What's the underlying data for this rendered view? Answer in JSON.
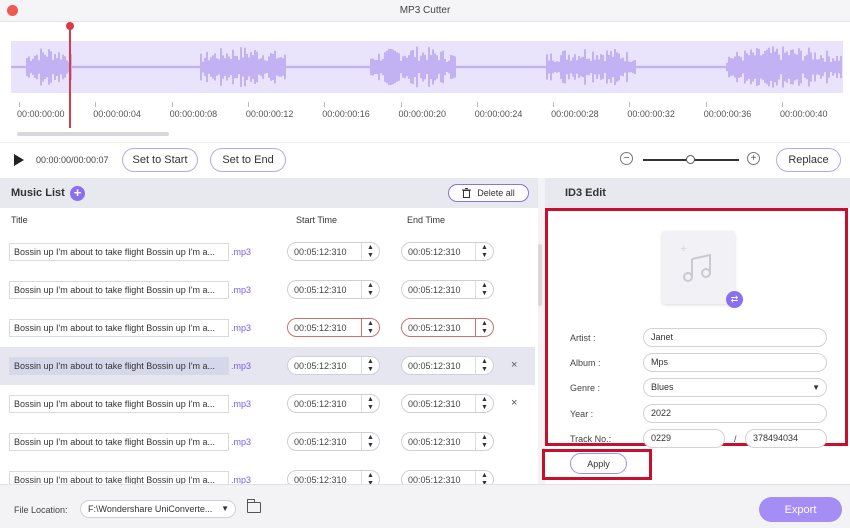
{
  "window": {
    "title": "MP3 Cutter"
  },
  "timeline": {
    "ticks": [
      "00:00:00:00",
      "00:00:00:04",
      "00:00:00:08",
      "00:00:00:12",
      "00:00:00:16",
      "00:00:00:20",
      "00:00:00:24",
      "00:00:00:28",
      "00:00:00:32",
      "00:00:00:36",
      "00:00:00:40"
    ]
  },
  "controls": {
    "time_readout": "00:00:00/00:00:07",
    "set_start_label": "Set to Start",
    "set_end_label": "Set to End",
    "zoom_minus": "−",
    "zoom_plus": "+",
    "replace_label": "Replace"
  },
  "music_list": {
    "title": "Music List",
    "delete_all_label": "Delete all",
    "columns": {
      "title": "Title",
      "start": "Start Time",
      "end": "End Time"
    },
    "rows": [
      {
        "name": "Bossin up I'm about to take flight Bossin up I'm a...",
        "ext": ".mp3",
        "start": "00:05:12:310",
        "end": "00:05:12:310",
        "selected": false,
        "error": false,
        "close": ""
      },
      {
        "name": "Bossin up I'm about to take flight Bossin up I'm a...",
        "ext": ".mp3",
        "start": "00:05:12:310",
        "end": "00:05:12:310",
        "selected": false,
        "error": false,
        "close": ""
      },
      {
        "name": "Bossin up I'm about to take flight Bossin up I'm a...",
        "ext": ".mp3",
        "start": "00:05:12:310",
        "end": "00:05:12:310",
        "selected": false,
        "error": true,
        "close": ""
      },
      {
        "name": "Bossin up I'm about to take flight Bossin up I'm a...",
        "ext": ".mp3",
        "start": "00:05:12:310",
        "end": "00:05:12:310",
        "selected": true,
        "error": false,
        "close": "×"
      },
      {
        "name": "Bossin up I'm about to take flight Bossin up I'm a...",
        "ext": ".mp3",
        "start": "00:05:12:310",
        "end": "00:05:12:310",
        "selected": false,
        "error": false,
        "close": "×"
      },
      {
        "name": "Bossin up I'm about to take flight Bossin up I'm a...",
        "ext": ".mp3",
        "start": "00:05:12:310",
        "end": "00:05:12:310",
        "selected": false,
        "error": false,
        "close": ""
      },
      {
        "name": "Bossin up I'm about to take flight Bossin up I'm a...",
        "ext": ".mp3",
        "start": "00:05:12:310",
        "end": "00:05:12:310",
        "selected": false,
        "error": false,
        "close": ""
      }
    ]
  },
  "id3": {
    "title": "ID3 Edit",
    "artist_label": "Artist :",
    "artist": "Janet",
    "album_label": "Album :",
    "album": "Mps",
    "genre_label": "Genre :",
    "genre": "Blues",
    "year_label": "Year :",
    "year": "2022",
    "track_label": "Track No.:",
    "track": "0229",
    "track_sep": "/",
    "track_total": "378494034",
    "apply_label": "Apply"
  },
  "footer": {
    "location_label": "File Location:",
    "location_value": "F:\\Wondershare UniConverte...",
    "export_label": "Export"
  },
  "colors": {
    "accent": "#8a6ff0",
    "wave": "#b9a6f2",
    "playhead": "#d93b4a",
    "highlight": "#c8102e"
  }
}
